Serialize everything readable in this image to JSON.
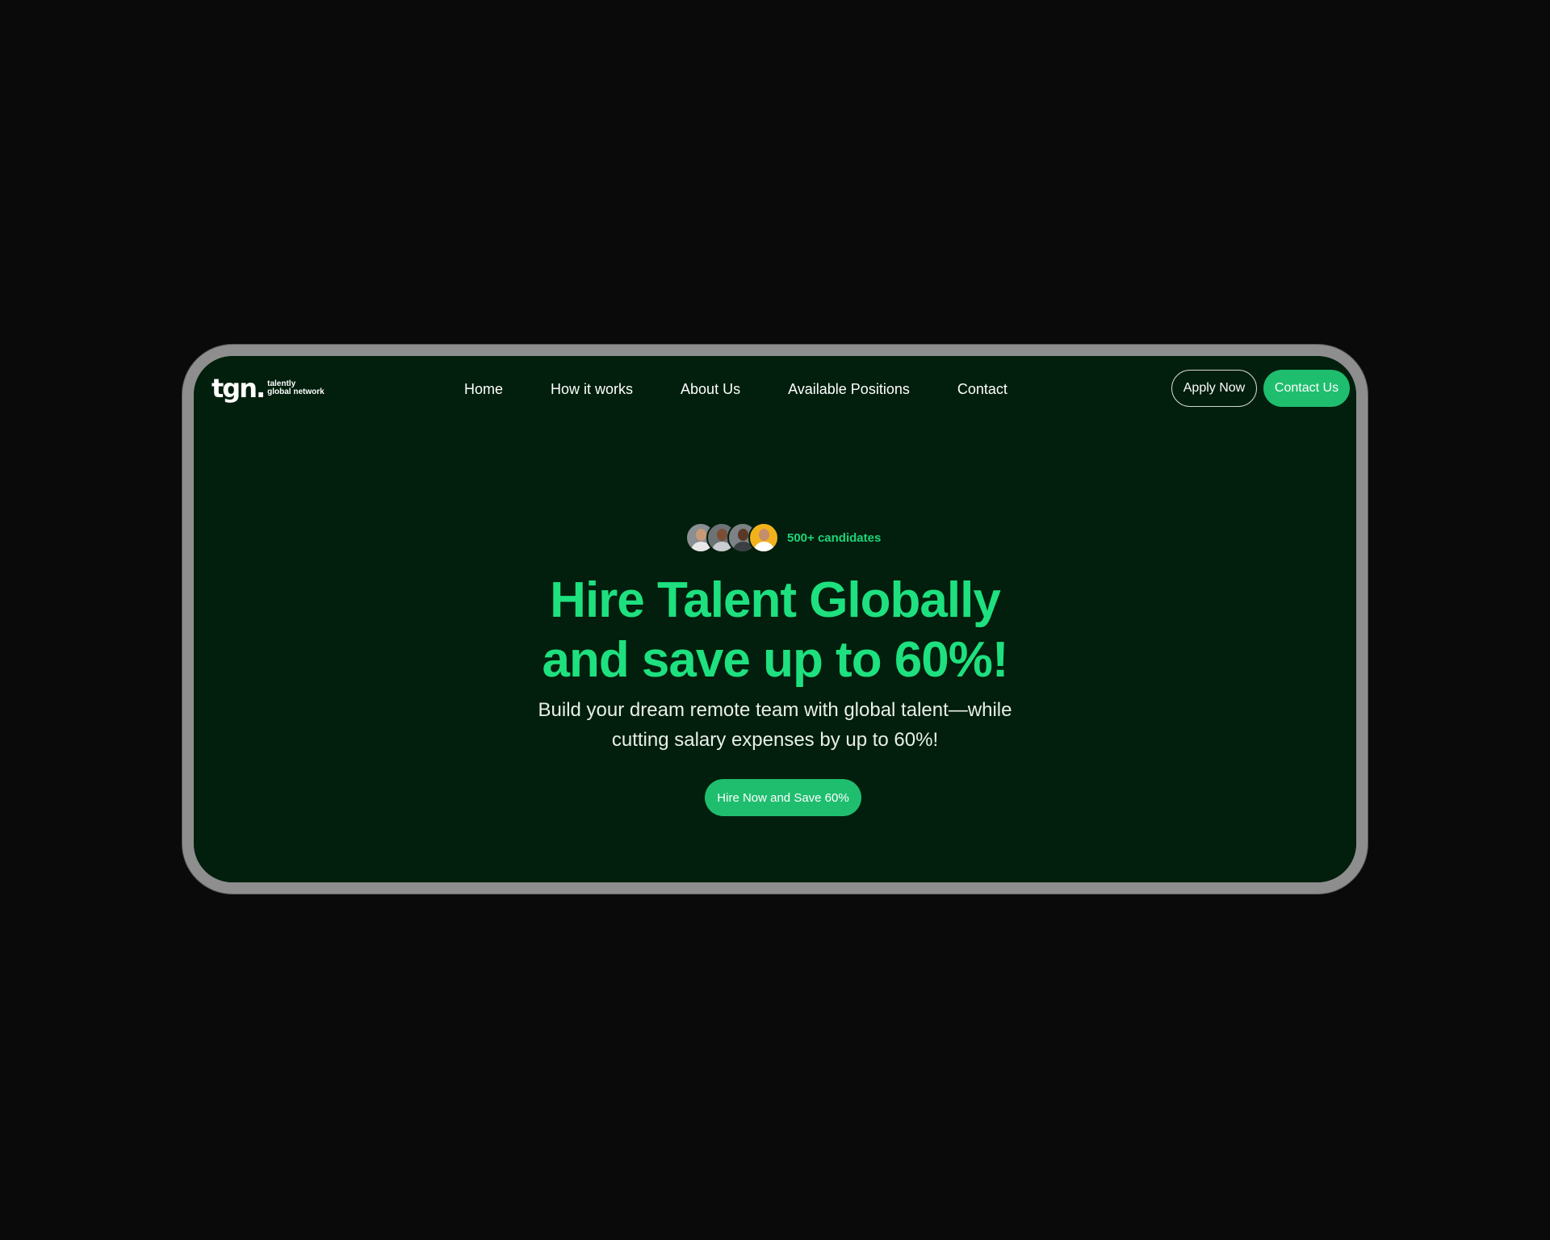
{
  "logo": {
    "mark": "tgn.",
    "line1": "talently",
    "line2": "global network"
  },
  "nav": {
    "items": [
      {
        "label": "Home"
      },
      {
        "label": "How it works"
      },
      {
        "label": "About Us"
      },
      {
        "label": "Available Positions"
      },
      {
        "label": "Contact"
      }
    ]
  },
  "header_actions": {
    "apply_label": "Apply Now",
    "contact_label": "Contact Us"
  },
  "hero": {
    "candidates_label": "500+ candidates",
    "headline_line1": "Hire Talent Globally",
    "headline_line2": "and save up to 60%!",
    "subhead_line1": "Build your dream remote team with global talent—while",
    "subhead_line2": "cutting salary expenses by up to 60%!",
    "cta_label": "Hire Now and Save 60%"
  },
  "colors": {
    "page_background": "#0a0a0a",
    "screen_background": "#011f0c",
    "accent_green": "#1fbe6e",
    "headline_green": "#1ee07f",
    "frame_gray": "#8e8e8e"
  }
}
